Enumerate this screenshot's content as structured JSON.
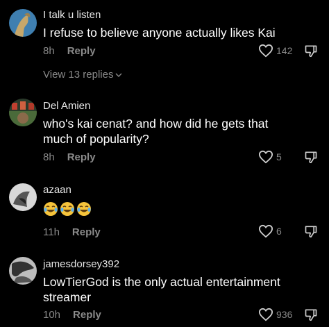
{
  "comments": [
    {
      "username": "I talk u listen",
      "text": "I refuse to believe anyone actually likes Kai",
      "time": "8h",
      "reply_label": "Reply",
      "likes": "142",
      "view_replies": "View 13 replies"
    },
    {
      "username": "Del Amien",
      "text": "who's kai cenat? and how did he gets that much of popularity?",
      "time": "8h",
      "reply_label": "Reply",
      "likes": "5"
    },
    {
      "username": "azaan",
      "emoji": "😂😂😂",
      "time": "11h",
      "reply_label": "Reply",
      "likes": "6"
    },
    {
      "username": "jamesdorsey392",
      "text": "LowTierGod is the only actual entertainment streamer",
      "time": "10h",
      "reply_label": "Reply",
      "likes": "936"
    }
  ],
  "colors": {
    "background": "#000000",
    "text": "#ffffff",
    "muted": "#8a8a8a"
  }
}
